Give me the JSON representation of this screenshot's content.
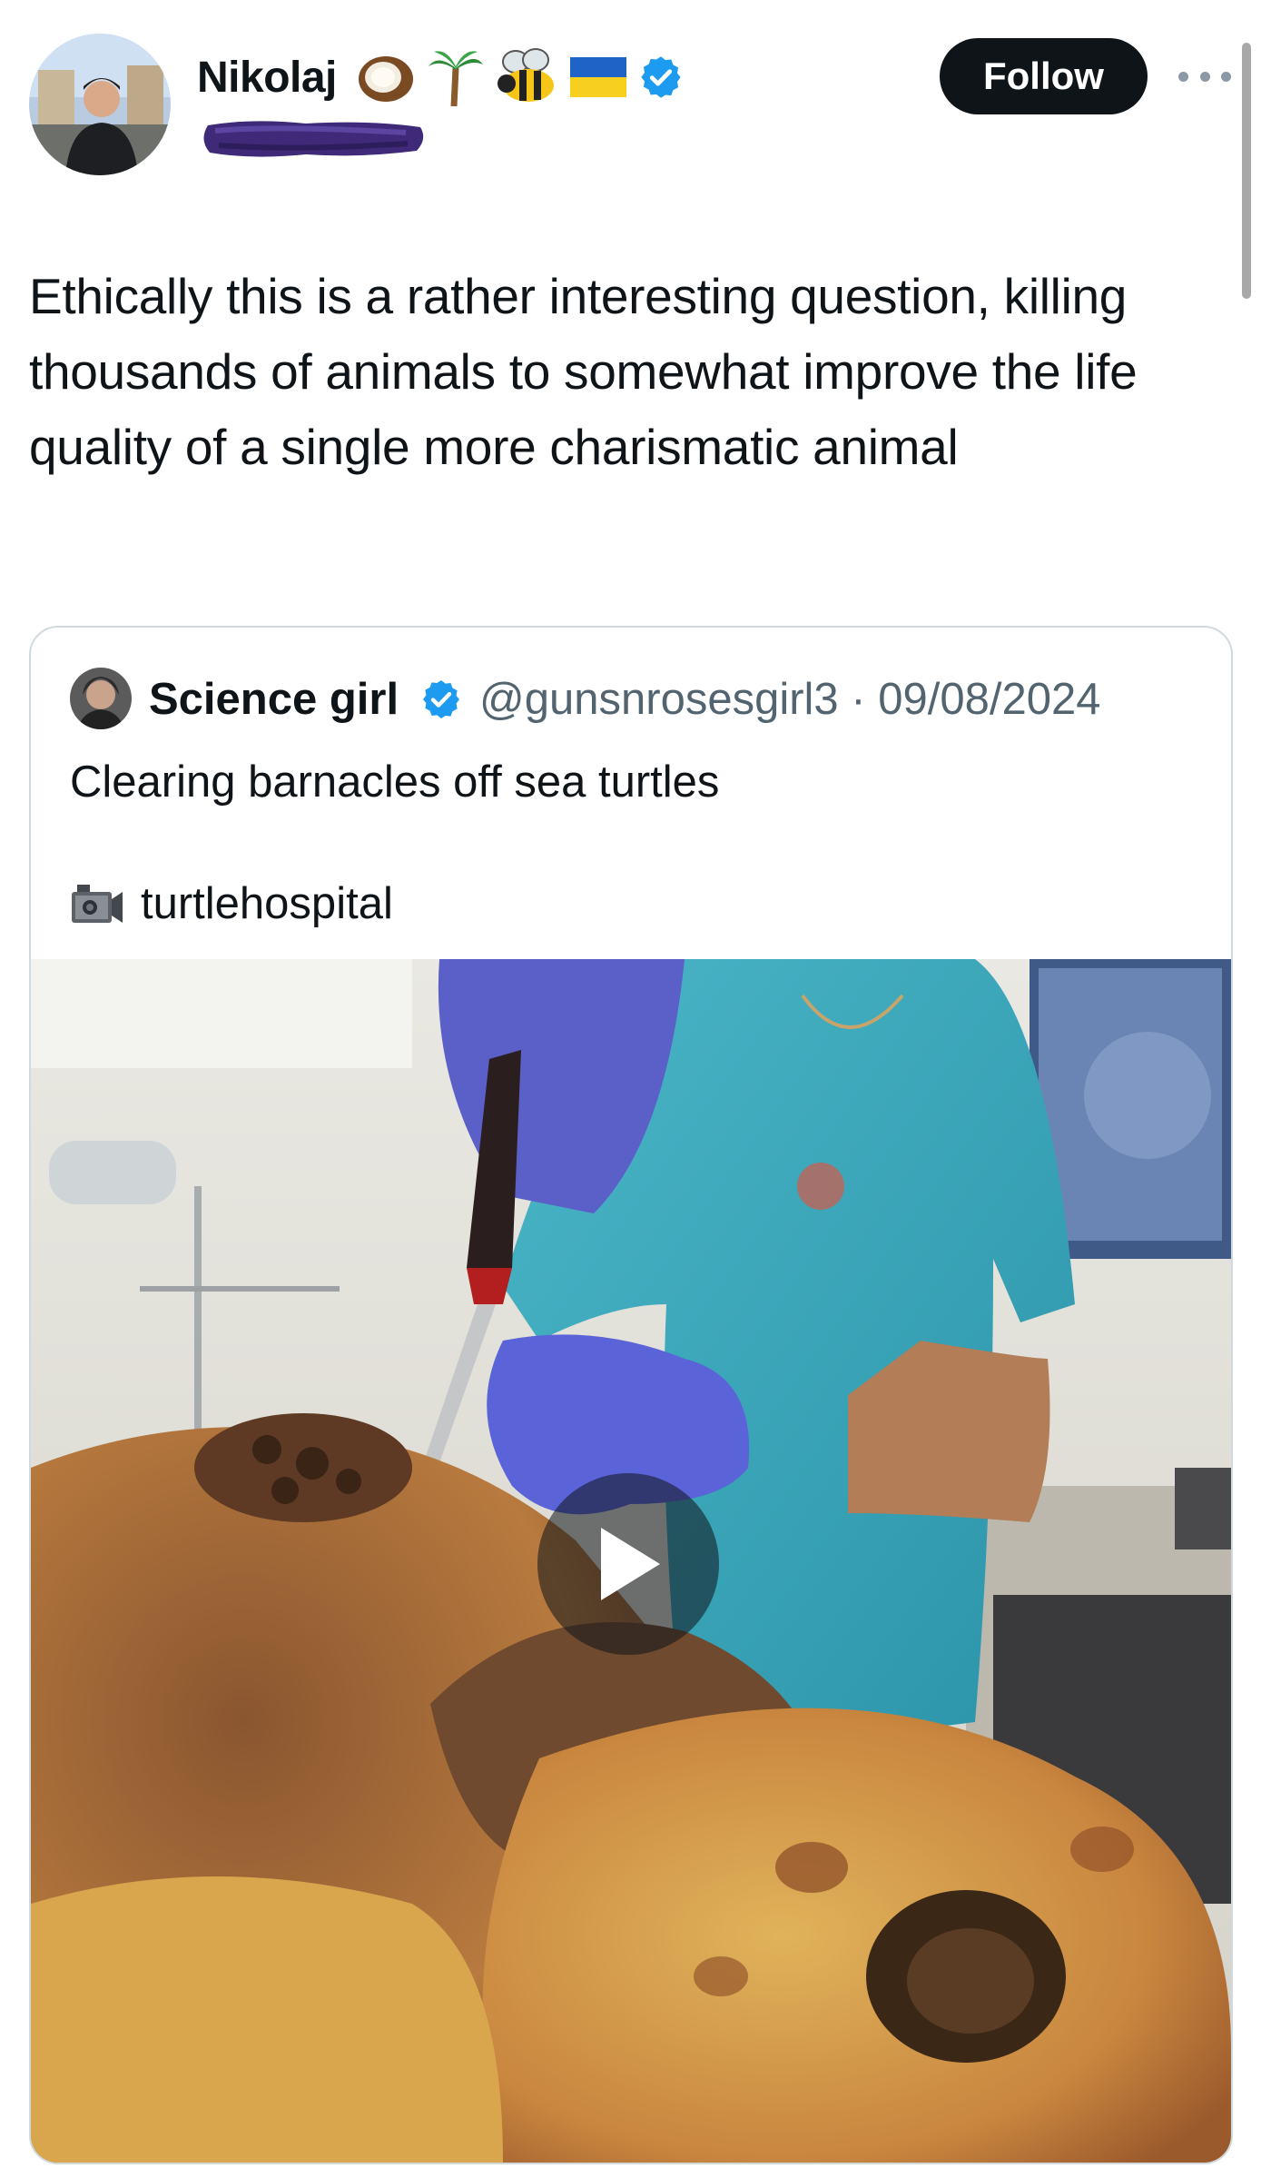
{
  "author": {
    "display_name": "Nikolaj",
    "emojis": [
      "coconut-emoji",
      "palm-tree-emoji",
      "bee-emoji",
      "ukraine-flag-emoji"
    ],
    "verified": true,
    "follow_label": "Follow"
  },
  "tweet": {
    "text": "Ethically this is a rather interesting question, killing thousands of animals to somewhat improve the life quality of a single more charismatic animal"
  },
  "quote": {
    "name": "Science girl",
    "verified": true,
    "handle_date": "@gunsnrosesgirl3 · 09/08/2024",
    "text": "Clearing barnacles off sea turtles",
    "credit_icon": "video-camera-icon",
    "credit": "turtlehospital",
    "media_type": "video"
  },
  "colors": {
    "text": "#0f1419",
    "secondary": "#536471",
    "verified": "#1d9bf0",
    "border": "#cfd9de",
    "button": "#0f1419"
  }
}
